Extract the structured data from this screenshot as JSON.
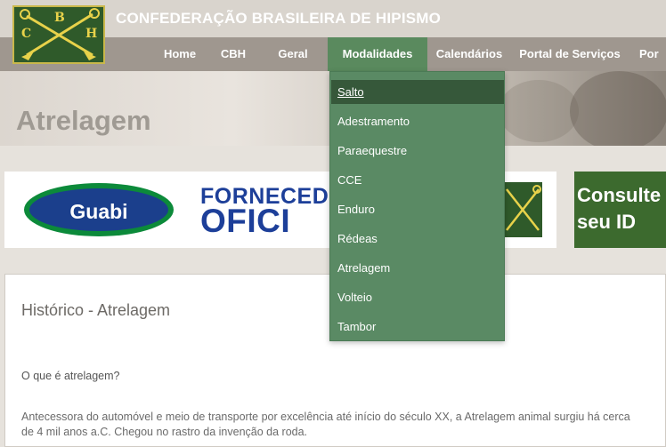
{
  "site": {
    "title": "CONFEDERAÇÃO BRASILEIRA DE HIPISMO",
    "logo_letters": [
      "C",
      "B",
      "H"
    ]
  },
  "nav": {
    "items": [
      {
        "label": "Home"
      },
      {
        "label": "CBH"
      },
      {
        "label": "Geral"
      },
      {
        "label": "Modalidades",
        "active": true
      },
      {
        "label": "Calendários"
      },
      {
        "label": "Portal de Serviços"
      },
      {
        "label": "Por"
      }
    ]
  },
  "dropdown": {
    "items": [
      "Salto",
      "Adestramento",
      "Paraequestre",
      "CCE",
      "Enduro",
      "Rédeas",
      "Atrelagem",
      "Volteio",
      "Tambor"
    ],
    "selected": "Salto"
  },
  "hero": {
    "title": "Atrelagem"
  },
  "banners": {
    "guabi": "Guabi",
    "fornecedor_line1": "FORNECED",
    "fornecedor_line2": "OFICI",
    "consult_line1": "Consulte",
    "consult_line2": "seu ID"
  },
  "content": {
    "heading": "Histórico - Atrelagem",
    "question": "O que é atrelagem?",
    "paragraph": "Antecessora do automóvel e meio de transporte por excelência até início do século XX, a Atrelagem animal surgiu há cerca de 4 mil anos a.C. Chegou no rastro da invenção da roda."
  },
  "colors": {
    "nav_bg": "#9f978f",
    "active": "#5a8a5e",
    "dropdown_bg": "#5a8a64",
    "dropdown_selected": "#36583a",
    "logo_bg": "#2f5a2a",
    "logo_gold": "#e8d24a"
  }
}
